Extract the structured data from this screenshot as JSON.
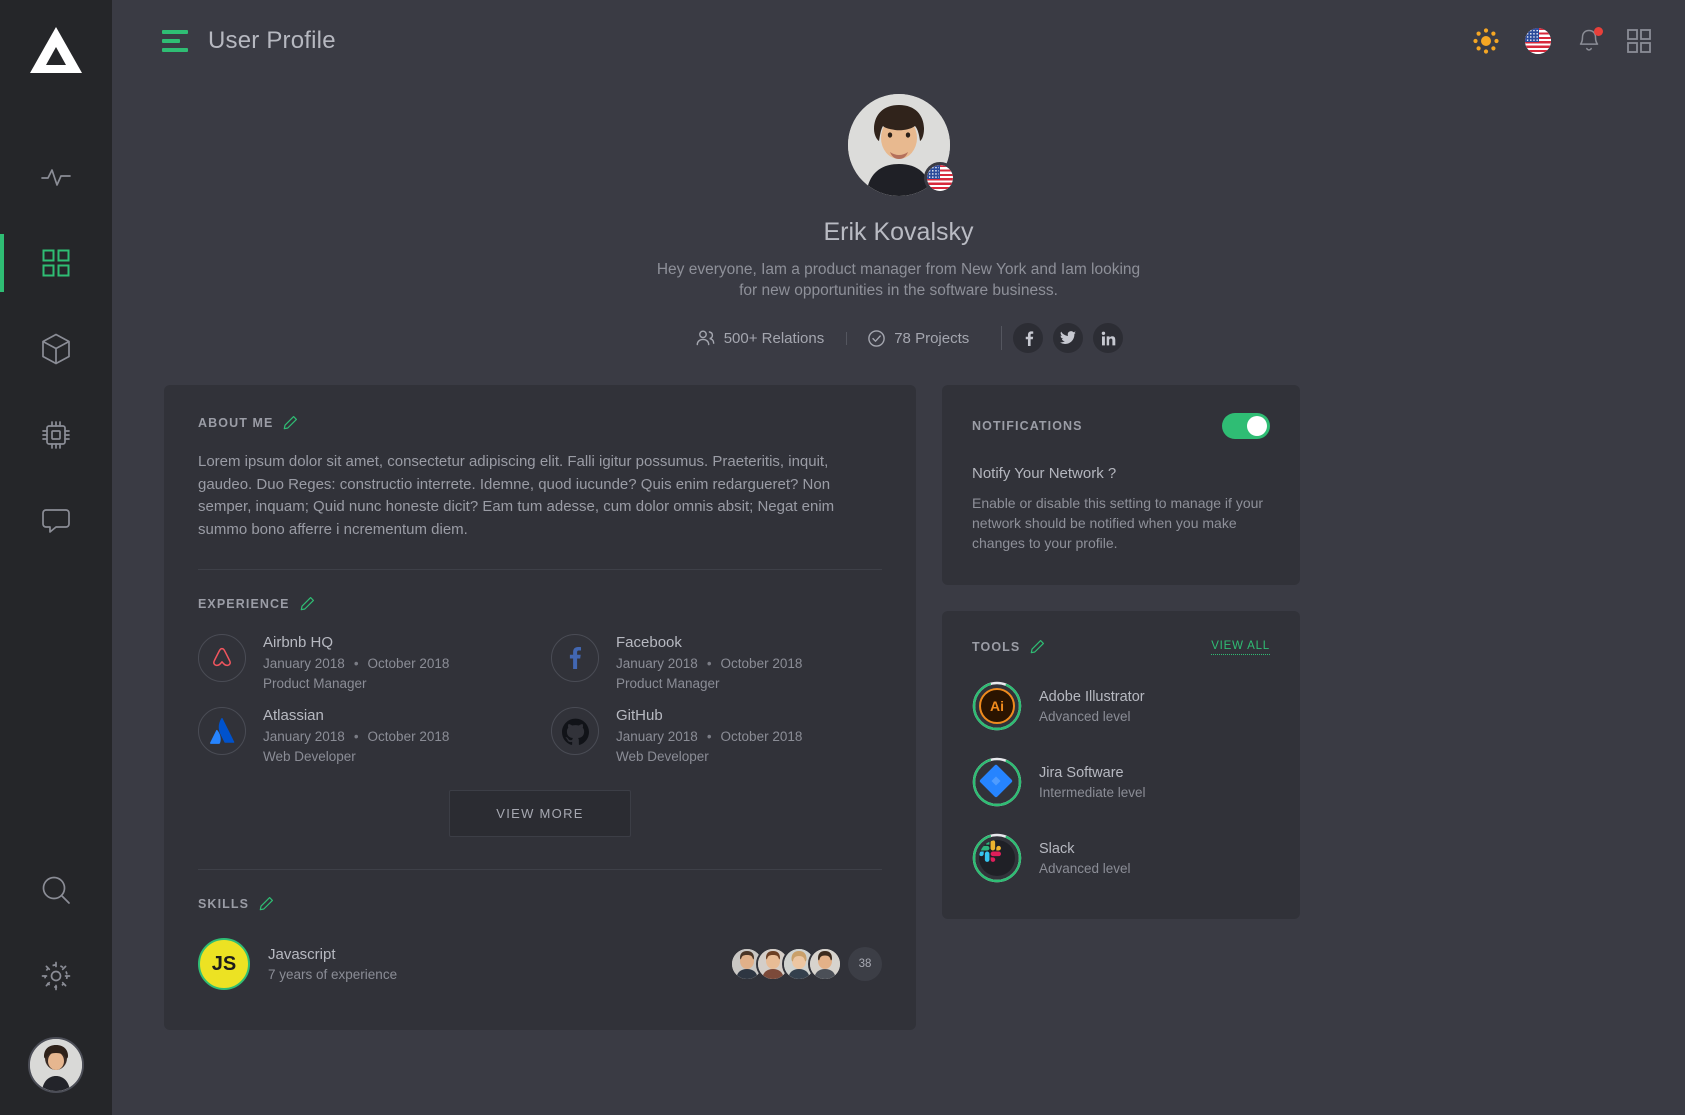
{
  "sidebar": {
    "logo_icon": "triangle-logo",
    "items": [
      {
        "icon": "activity-pulse-icon",
        "name": "activity",
        "active": false
      },
      {
        "icon": "grid-dashboard-icon",
        "name": "dashboard",
        "active": true
      },
      {
        "icon": "cube-box-icon",
        "name": "products",
        "active": false
      },
      {
        "icon": "chip-cpu-icon",
        "name": "devices",
        "active": false
      },
      {
        "icon": "chat-bubble-icon",
        "name": "messages",
        "active": false
      }
    ],
    "bottom_items": [
      {
        "icon": "search-icon",
        "name": "search"
      },
      {
        "icon": "gear-settings-icon",
        "name": "settings"
      }
    ],
    "avatar_name": "user-avatar"
  },
  "header": {
    "menu_icon": "hamburger-menu-icon",
    "title": "User Profile",
    "actions": [
      {
        "icon": "sun-brightness-icon",
        "name": "theme-toggle"
      },
      {
        "icon": "us-flag-icon",
        "name": "language-selector"
      },
      {
        "icon": "bell-notification-icon",
        "name": "notifications",
        "badge": true
      },
      {
        "icon": "grid-apps-icon",
        "name": "apps-menu"
      }
    ]
  },
  "profile": {
    "avatar_name": "profile-avatar",
    "country_flag": "us-flag-icon",
    "name": "Erik Kovalsky",
    "bio": "Hey everyone,  Iam a product manager from New York and Iam looking for new opportunities in the software business.",
    "stats": [
      {
        "icon": "people-icon",
        "label": "500+ Relations"
      },
      {
        "icon": "check-circle-icon",
        "label": "78 Projects"
      }
    ],
    "socials": [
      {
        "icon": "facebook-icon",
        "glyph": "f"
      },
      {
        "icon": "twitter-icon",
        "glyph": "t"
      },
      {
        "icon": "linkedin-icon",
        "glyph": "in"
      }
    ]
  },
  "about": {
    "title": "ABOUT ME",
    "edit_icon": "pencil-edit-icon",
    "text": "Lorem ipsum dolor sit amet, consectetur adipiscing elit. Falli igitur possumus. Praeteritis, inquit, gaudeo. Duo Reges: constructio interrete. Idemne, quod iucunde? Quis enim redargueret? Non semper, inquam; Quid nunc honeste dicit? Eam tum adesse, cum dolor omnis absit; Negat enim summo bono afferre i ncrementum diem."
  },
  "experience": {
    "title": "EXPERIENCE",
    "edit_icon": "pencil-edit-icon",
    "items": [
      {
        "company": "Airbnb HQ",
        "logo": "airbnb-icon",
        "start": "January 2018",
        "end": "October 2018",
        "role": "Product Manager"
      },
      {
        "company": "Facebook",
        "logo": "facebook-icon",
        "start": "January 2018",
        "end": "October 2018",
        "role": "Product Manager"
      },
      {
        "company": "Atlassian",
        "logo": "atlassian-icon",
        "start": "January 2018",
        "end": "October 2018",
        "role": "Web Developer"
      },
      {
        "company": "GitHub",
        "logo": "github-icon",
        "start": "January 2018",
        "end": "October 2018",
        "role": "Web Developer"
      }
    ],
    "view_more_label": "VIEW MORE"
  },
  "skills": {
    "title": "SKILLS",
    "edit_icon": "pencil-edit-icon",
    "items": [
      {
        "name": "Javascript",
        "logo_text": "JS",
        "experience": "7 years of experience",
        "avatars": 4,
        "more_count": "38"
      }
    ]
  },
  "notifications": {
    "title": "NOTIFICATIONS",
    "toggle_on": true,
    "question": "Notify Your Network ?",
    "description": "Enable or disable this setting to manage if your network should be notified when you make changes to your profile."
  },
  "tools": {
    "title": "TOOLS",
    "edit_icon": "pencil-edit-icon",
    "view_all_label": "VIEW ALL",
    "items": [
      {
        "name": "Adobe Illustrator",
        "level": "Advanced level",
        "logo": "adobe-illustrator-icon",
        "progress": 88
      },
      {
        "name": "Jira Software",
        "level": "Intermediate level",
        "logo": "jira-icon",
        "progress": 88
      },
      {
        "name": "Slack",
        "level": "Advanced level",
        "logo": "slack-icon",
        "progress": 88
      }
    ]
  },
  "colors": {
    "accent_green": "#2fbd74",
    "bg_app": "#3a3b44",
    "bg_sidebar": "#252629",
    "bg_card": "#313239",
    "badge_red": "#e8403a",
    "sun_orange": "#f5a623"
  }
}
